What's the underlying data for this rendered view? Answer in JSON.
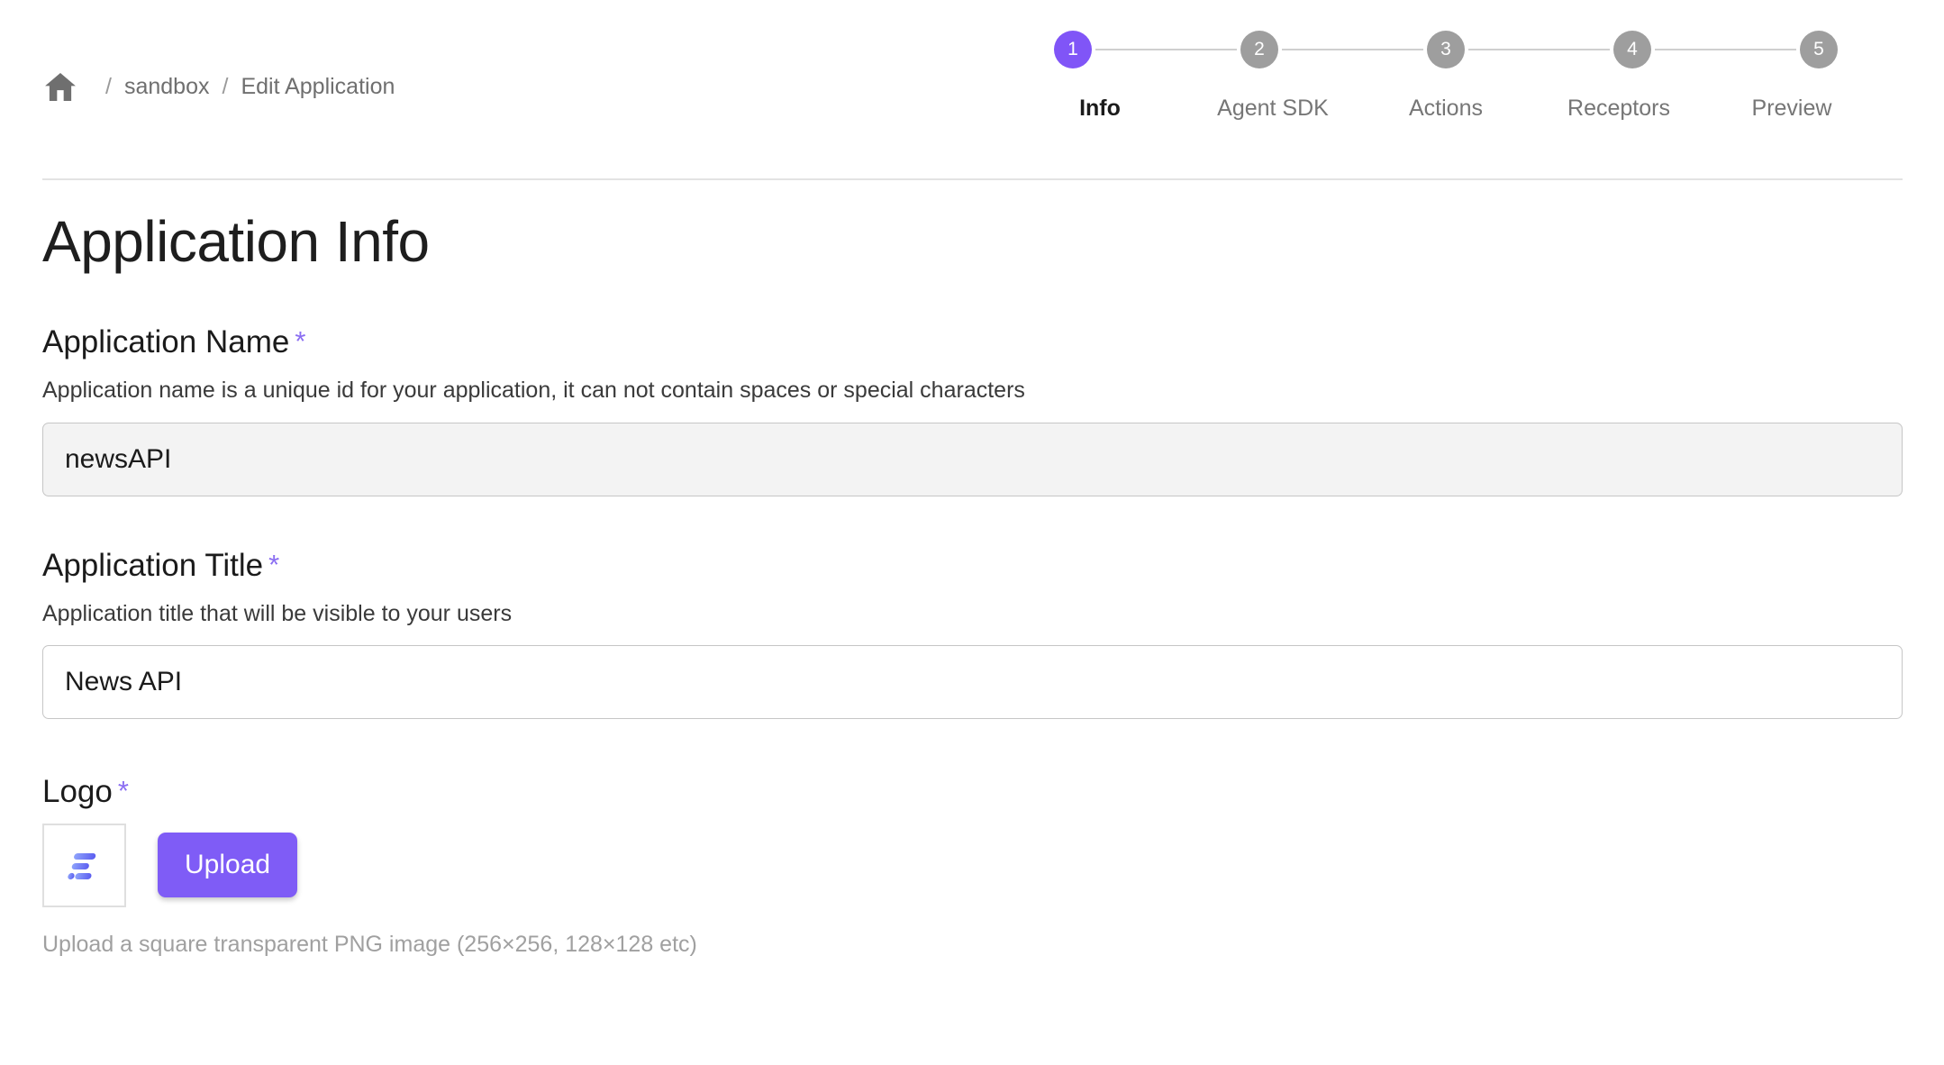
{
  "breadcrumb": {
    "home_icon": "home-icon",
    "separator": "/",
    "items": [
      {
        "label": "sandbox"
      },
      {
        "label": "Edit Application"
      }
    ]
  },
  "stepper": {
    "active_index": 0,
    "active_color": "#8055f7",
    "inactive_color": "#9e9e9e",
    "steps": [
      {
        "number": "1",
        "label": "Info"
      },
      {
        "number": "2",
        "label": "Agent SDK"
      },
      {
        "number": "3",
        "label": "Actions"
      },
      {
        "number": "4",
        "label": "Receptors"
      },
      {
        "number": "5",
        "label": "Preview"
      }
    ]
  },
  "page": {
    "title": "Application Info"
  },
  "fields": {
    "app_name": {
      "label": "Application Name",
      "required_marker": "*",
      "help": "Application name is a unique id for your application, it can not contain spaces or special characters",
      "value": "newsAPI",
      "placeholder": "Application Name",
      "readonly": true
    },
    "app_title": {
      "label": "Application Title",
      "required_marker": "*",
      "help": "Application title that will be visible to your users",
      "value": "News API",
      "placeholder": "Application Title",
      "readonly": false
    },
    "logo": {
      "label": "Logo",
      "required_marker": "*",
      "upload_label": "Upload",
      "help": "Upload a square transparent PNG image (256×256, 128×128 etc)",
      "thumbnail_icon": "app-logo-icon",
      "button_color": "#7f5cf6"
    }
  },
  "theme": {
    "accent": "#7f5cf6",
    "required_star": "#8b6ef2",
    "text": "#1b1b1b",
    "muted_text": "#767676",
    "help_text": "#a0a0a0",
    "divider": "#e3e3e3",
    "input_border": "#c6c6c6",
    "readonly_bg": "#f3f3f3"
  }
}
